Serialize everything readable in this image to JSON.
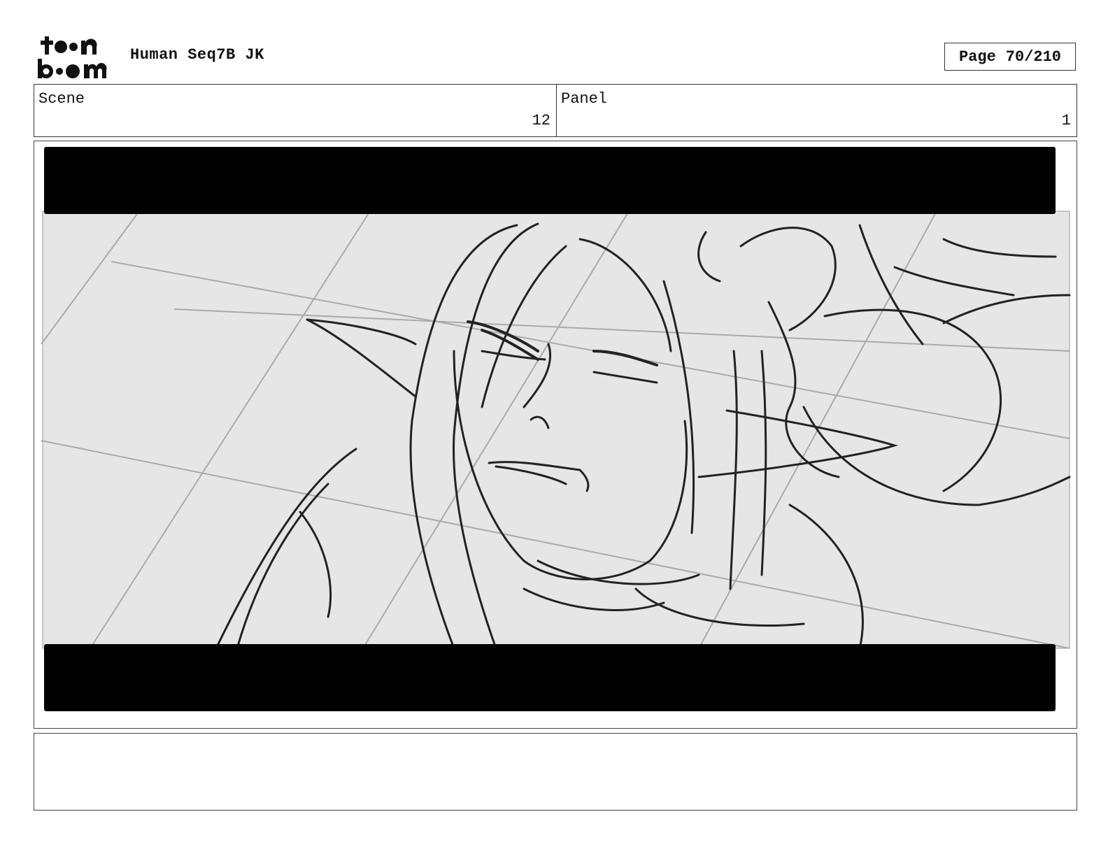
{
  "header": {
    "logo_text": "toon boom",
    "title": "Human Seq7B JK",
    "page_label": "Page",
    "page_value": "70/210"
  },
  "info": {
    "scene_label": "Scene",
    "scene_value": "12",
    "panel_label": "Panel",
    "panel_value": "1"
  },
  "frame": {
    "image_description": "",
    "letterbox_color": "#000000",
    "background_color": "#e6e6e6",
    "line_color": "#222222"
  },
  "notes": {
    "text": ""
  }
}
